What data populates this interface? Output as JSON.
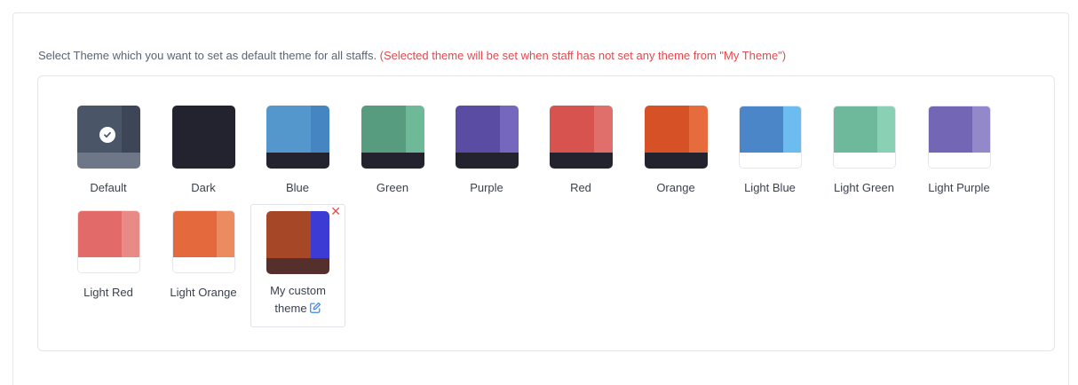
{
  "instruction": {
    "text": "Select Theme which you want to set as default theme for all staffs. ",
    "note": "(Selected theme will be set when staff has not set any theme from \"My Theme\")"
  },
  "themes": [
    {
      "label": "Default",
      "main": "#4a5568",
      "side": "#3d4656",
      "bottom": "#6e7787",
      "selected": true
    },
    {
      "label": "Dark",
      "main": "#22232f",
      "side": "#22232f",
      "bottom": "#22232f",
      "selected": false
    },
    {
      "label": "Blue",
      "main": "#5497cd",
      "side": "#4585c2",
      "bottom": "#22232f",
      "selected": false
    },
    {
      "label": "Green",
      "main": "#579c7f",
      "side": "#6db998",
      "bottom": "#22232f",
      "selected": false
    },
    {
      "label": "Purple",
      "main": "#5a4ca3",
      "side": "#7567be",
      "bottom": "#22232f",
      "selected": false
    },
    {
      "label": "Red",
      "main": "#d6534f",
      "side": "#e06e6a",
      "bottom": "#22232f",
      "selected": false
    },
    {
      "label": "Orange",
      "main": "#d75127",
      "side": "#e66c3d",
      "bottom": "#22232f",
      "selected": false
    },
    {
      "label": "Light Blue",
      "main": "#4a86c8",
      "side": "#6cbcef",
      "bottom": "#ffffff",
      "selected": false
    },
    {
      "label": "Light Green",
      "main": "#6eb89b",
      "side": "#89d0b5",
      "bottom": "#ffffff",
      "selected": false
    },
    {
      "label": "Light Purple",
      "main": "#7366b4",
      "side": "#9388c9",
      "bottom": "#ffffff",
      "selected": false
    },
    {
      "label": "Light Red",
      "main": "#e26b69",
      "side": "#e88a86",
      "bottom": "#ffffff",
      "selected": false
    },
    {
      "label": "Light Orange",
      "main": "#e4693c",
      "side": "#ea8b60",
      "bottom": "#ffffff",
      "selected": false
    }
  ],
  "custom_theme": {
    "label_line1": "My custom",
    "label_line2": "theme",
    "main": "#a64727",
    "side": "#3c3cd4",
    "bottom": "#542f2b",
    "remove_icon": "close-icon",
    "edit_icon": "edit-icon"
  },
  "colors": {
    "accent_red": "#e5484d",
    "edit_blue": "#3b82f6"
  }
}
